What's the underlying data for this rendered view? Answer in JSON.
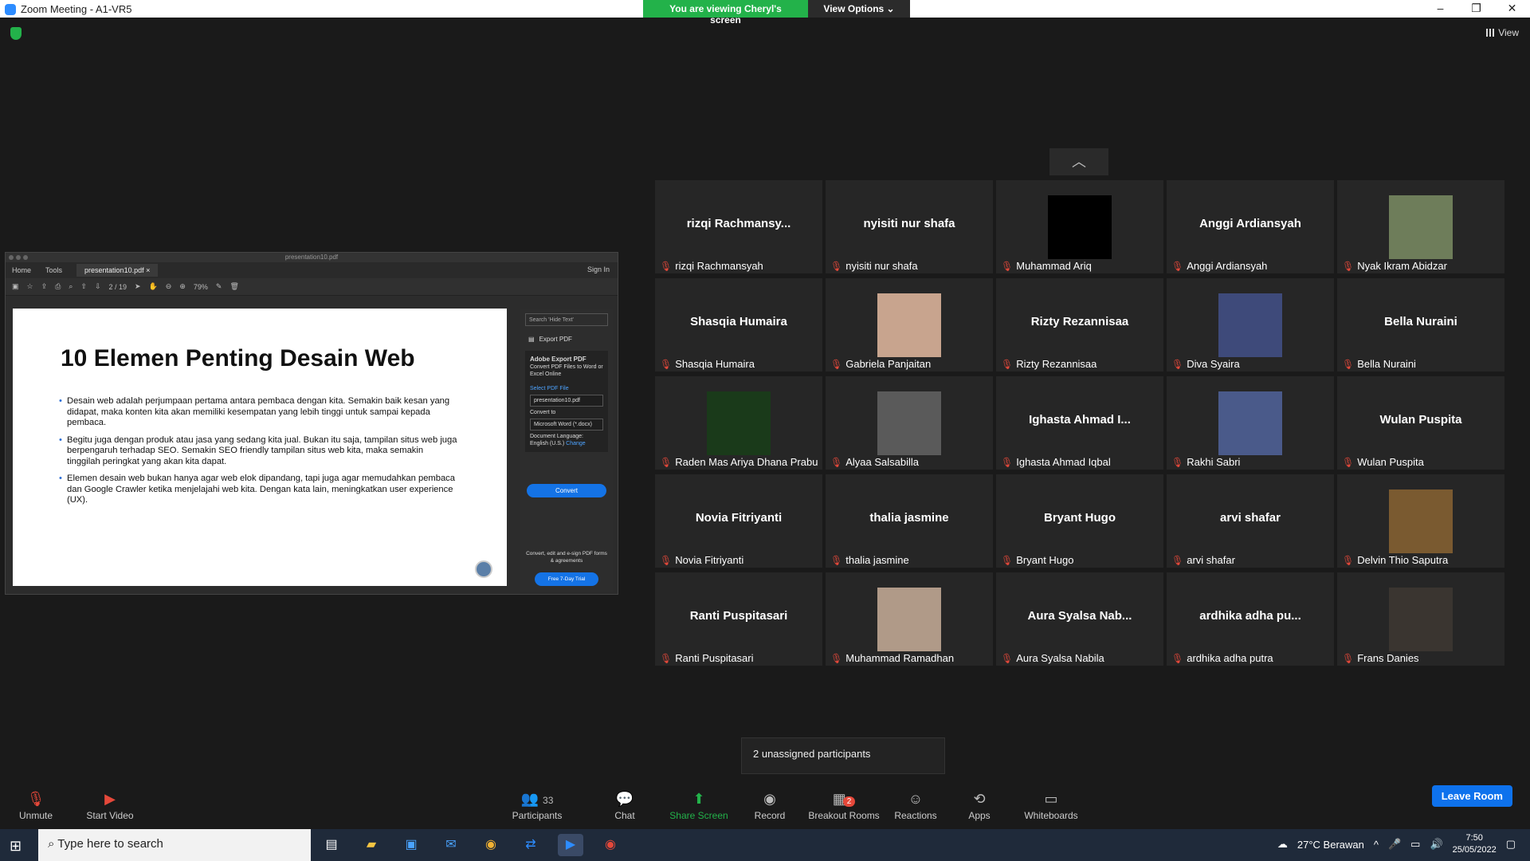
{
  "window": {
    "title": "Zoom Meeting - A1-VR5",
    "min": "–",
    "restore": "❐",
    "close": "✕"
  },
  "banner": {
    "viewing": "You are viewing Cheryl's screen",
    "view_options": "View Options ⌄"
  },
  "view_label": "View",
  "shared": {
    "window_title": "presentation10.pdf",
    "tabs": {
      "home": "Home",
      "tools": "Tools",
      "file": "presentation10.pdf ×",
      "sign_in": "Sign In"
    },
    "page": "2 / 19",
    "zoom": "79%",
    "slide": {
      "title": "10 Elemen Penting Desain Web",
      "bullets": [
        "Desain web adalah perjumpaan pertama antara pembaca dengan kita. Semakin baik kesan yang didapat, maka konten  kita akan memiliki kesempatan yang lebih tinggi untuk sampai kepada pembaca.",
        "Begitu juga dengan produk atau jasa yang sedang kita jual. Bukan itu saja, tampilan situs web juga berpengaruh terhadap SEO. Semakin SEO friendly tampilan situs web kita, maka semakin tinggilah peringkat yang akan kita dapat.",
        "Elemen desain web bukan hanya agar web elok dipandang, tapi juga agar memudahkan pembaca dan Google Crawler ketika menjelajahi web kita. Dengan kata lain, meningkatkan user experience (UX)."
      ]
    },
    "panel": {
      "search": "Search 'Hide Text'",
      "export": "Export PDF",
      "adobe": "Adobe Export PDF",
      "desc": "Convert PDF Files to Word or Excel Online",
      "select": "Select PDF File",
      "file": "presentation10.pdf",
      "convert_to": "Convert to",
      "format": "Microsoft Word (*.docx)",
      "doc_lang": "Document Language:",
      "lang": "English (U.S.)",
      "change": "Change",
      "convert": "Convert",
      "foot": "Convert, edit and e-sign PDF forms & agreements",
      "trial": "Free 7-Day Trial"
    }
  },
  "tiles": [
    {
      "big": "rizqi  Rachmansy...",
      "name": "rizqi Rachmansyah",
      "photo": false
    },
    {
      "big": "nyisiti nur shafa",
      "name": "nyisiti nur shafa",
      "photo": false
    },
    {
      "big": "",
      "name": "Muhammad Ariq",
      "photo": true,
      "color": "#000000"
    },
    {
      "big": "Anggi Ardiansyah",
      "name": "Anggi Ardiansyah",
      "photo": false
    },
    {
      "big": "",
      "name": "Nyak Ikram Abidzar",
      "photo": true,
      "color": "#6e7d5a"
    },
    {
      "big": "Shasqia Humaira",
      "name": "Shasqia Humaira",
      "photo": false
    },
    {
      "big": "",
      "name": "Gabriela Panjaitan",
      "photo": true,
      "color": "#c8a48e"
    },
    {
      "big": "Rizty Rezannisaa",
      "name": "Rizty Rezannisaa",
      "photo": false
    },
    {
      "big": "",
      "name": "Diva Syaira",
      "photo": true,
      "color": "#3e4a7a"
    },
    {
      "big": "Bella Nuraini",
      "name": "Bella Nuraini",
      "photo": false
    },
    {
      "big": "",
      "name": "Raden Mas Ariya Dhana Prabu",
      "photo": true,
      "color": "#1a3a1a"
    },
    {
      "big": "",
      "name": "Alyaa Salsabilla",
      "photo": true,
      "color": "#5a5a5a"
    },
    {
      "big": "Ighasta Ahmad I...",
      "name": "Ighasta Ahmad Iqbal",
      "photo": false
    },
    {
      "big": "",
      "name": "Rakhi Sabri",
      "photo": true,
      "color": "#4a5a8a"
    },
    {
      "big": "Wulan Puspita",
      "name": "Wulan Puspita",
      "photo": false
    },
    {
      "big": "Novia Fitriyanti",
      "name": "Novia Fitriyanti",
      "photo": false
    },
    {
      "big": "thalia jasmine",
      "name": "thalia jasmine",
      "photo": false
    },
    {
      "big": "Bryant Hugo",
      "name": "Bryant Hugo",
      "photo": false
    },
    {
      "big": "arvi shafar",
      "name": "arvi shafar",
      "photo": false
    },
    {
      "big": "",
      "name": "Delvin Thio Saputra",
      "photo": true,
      "color": "#7a5a30"
    },
    {
      "big": "Ranti Puspitasari",
      "name": "Ranti Puspitasari",
      "photo": false
    },
    {
      "big": "",
      "name": "Muhammad Ramadhan",
      "photo": true,
      "color": "#b09a88"
    },
    {
      "big": "Aura Syalsa Nab...",
      "name": "Aura Syalsa Nabila",
      "photo": false
    },
    {
      "big": "ardhika  adha  pu...",
      "name": "ardhika adha putra",
      "photo": false
    },
    {
      "big": "",
      "name": "Frans Danies",
      "photo": true,
      "color": "#3a3530"
    }
  ],
  "popup": "2 unassigned participants",
  "controls": {
    "unmute": "Unmute",
    "start_video": "Start Video",
    "participants": "Participants",
    "participants_count": "33",
    "chat": "Chat",
    "share": "Share Screen",
    "record": "Record",
    "breakout": "Breakout Rooms",
    "breakout_count": "2",
    "reactions": "Reactions",
    "apps": "Apps",
    "whiteboards": "Whiteboards",
    "leave": "Leave Room"
  },
  "taskbar": {
    "search": "Type here to search",
    "weather": "27°C  Berawan",
    "time": "7:50",
    "date": "25/05/2022"
  }
}
